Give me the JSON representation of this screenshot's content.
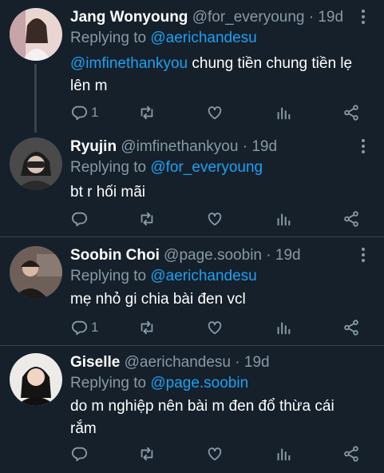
{
  "tweets": [
    {
      "name": "Jang Wonyoung",
      "handle": "@for_everyoung",
      "dot": "·",
      "time": "19d",
      "replying_prefix": "Replying to",
      "replying_to": "@aerichandesu",
      "body_mention": "@imfinethankyou",
      "body_text": " chung tiền chung tiền lẹ lên m",
      "reply_count": "1"
    },
    {
      "name": "Ryujin",
      "handle": "@imfinethankyou",
      "dot": "·",
      "time": "19d",
      "replying_prefix": "Replying to",
      "replying_to": "@for_everyoung",
      "body_text": "bt r hối mãi",
      "reply_count": ""
    },
    {
      "name": "Soobin Choi",
      "handle": "@page.soobin",
      "dot": "·",
      "time": "19d",
      "replying_prefix": "Replying to",
      "replying_to": "@aerichandesu",
      "body_text": "mẹ nhỏ gi chia bài đen vcl",
      "reply_count": "1"
    },
    {
      "name": "Giselle",
      "handle": "@aerichandesu",
      "dot": "·",
      "time": "19d",
      "replying_prefix": "Replying to",
      "replying_to": "@page.soobin",
      "body_text": "do m nghiệp nên bài m đen đổ thừa cái rắm",
      "reply_count": ""
    }
  ],
  "colors": {
    "background": "#15202b",
    "muted": "#8899a6",
    "link": "#1da1f2",
    "divider": "#38444d"
  },
  "icons": [
    "reply-icon",
    "retweet-icon",
    "like-icon",
    "analytics-icon",
    "share-icon",
    "more-icon"
  ]
}
